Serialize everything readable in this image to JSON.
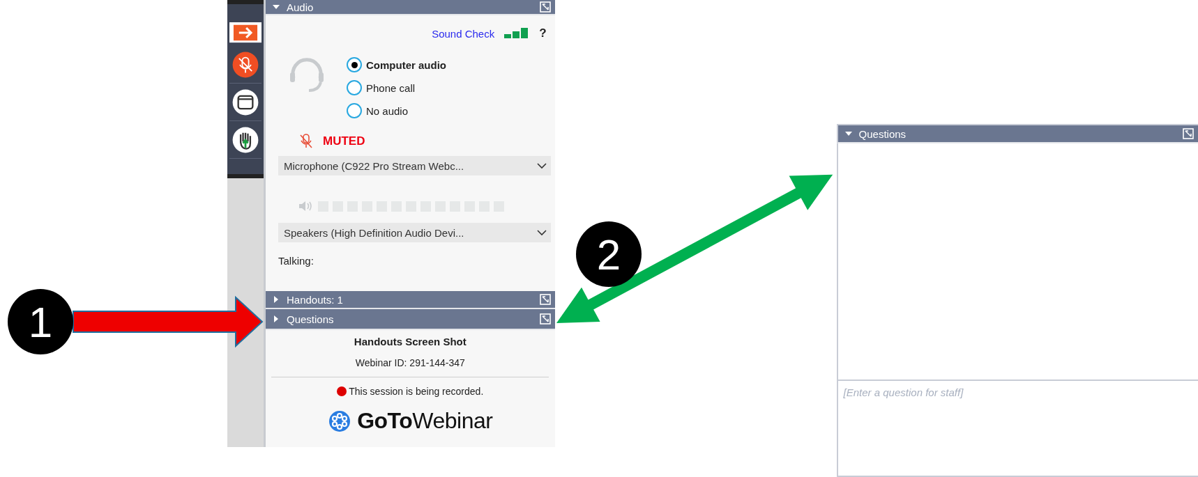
{
  "side_toolbar": [
    {
      "kind": "arrow",
      "selected": true
    },
    {
      "kind": "mic",
      "selected": false
    },
    {
      "kind": "window",
      "selected": false
    },
    {
      "kind": "hand",
      "selected": false
    }
  ],
  "audio": {
    "title": "Audio",
    "expanded": true,
    "sound_check": "Sound Check",
    "help": "?",
    "options": [
      {
        "label": "Computer audio",
        "selected": true
      },
      {
        "label": "Phone call",
        "selected": false
      },
      {
        "label": "No audio",
        "selected": false
      }
    ],
    "status": "MUTED",
    "microphone": "Microphone (C922 Pro Stream Webc...",
    "speakers": "Speakers (High Definition Audio Devi...",
    "talking": "Talking:"
  },
  "sections": [
    {
      "title": "Handouts: 1",
      "expanded": false
    },
    {
      "title": "Questions",
      "expanded": false
    }
  ],
  "footer": {
    "title": "Handouts Screen Shot",
    "webinar_id": "Webinar ID: 291-144-347",
    "recording": "This session is being recorded.",
    "logo": "**GoTo**Webinar"
  },
  "questions_panel": {
    "title": "Questions",
    "expanded": true,
    "placeholder": "[Enter a question for staff]"
  },
  "annotations": [
    {
      "kind": "badge",
      "label": "1"
    },
    {
      "kind": "badge",
      "label": "2"
    }
  ],
  "arrows": [
    {
      "kind": "single",
      "color": "#ee0000"
    },
    {
      "kind": "double",
      "color": "#00b050"
    }
  ]
}
